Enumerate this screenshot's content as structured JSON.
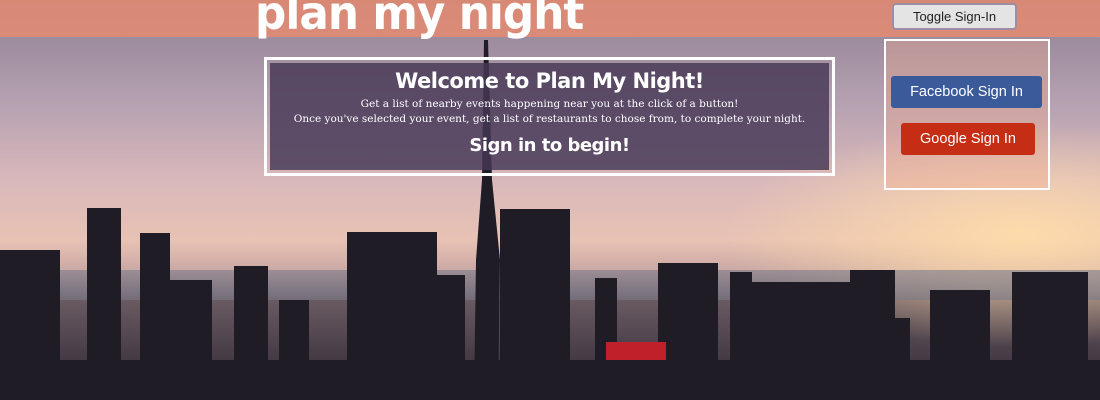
{
  "header": {
    "logo": "plan my night",
    "toggle_label": "Toggle Sign-In",
    "bar_color": "#ec8c6e"
  },
  "welcome": {
    "title": "Welcome to Plan My Night!",
    "line1": "Get a list of nearby events happening near you at the click of a button!",
    "line2": "Once you've selected your event, get a list of restaurants to chose from, to complete your night.",
    "cta": "Sign in to begin!"
  },
  "signin": {
    "facebook_label": "Facebook Sign In",
    "google_label": "Google Sign In",
    "facebook_color": "#3b5a9a",
    "google_color": "#c52d14"
  },
  "background": {
    "image": "city-skyline-sunset"
  }
}
